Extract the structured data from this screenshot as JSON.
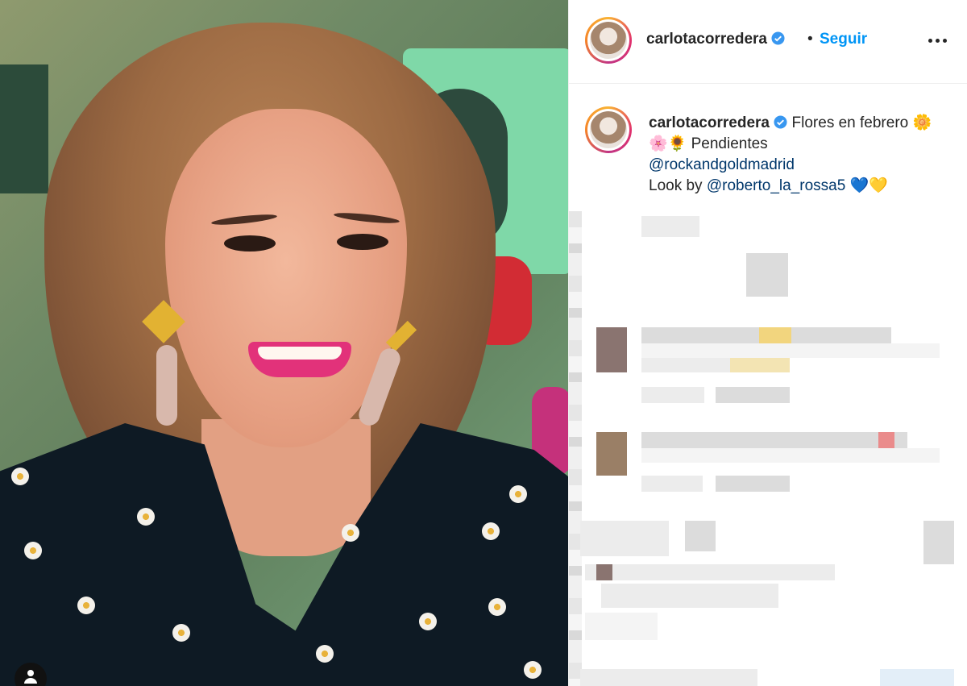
{
  "post": {
    "author": "carlotacorredera",
    "verified_icon": "verified-badge-icon",
    "separator": "•",
    "follow_label": "Seguir",
    "more_icon": "more-options-icon"
  },
  "caption": {
    "author": "carlotacorredera",
    "line1_text": "Flores en febrero",
    "emojis_1": "🌼🌸🌻",
    "line1_tail": "Pendientes",
    "mention_1": "@rockandgoldmadrid",
    "line3_prefix": "Look by",
    "mention_2": "@roberto_la_rossa5",
    "emojis_2": "💙💛"
  },
  "colors": {
    "accent": "#0095f6",
    "verified": "#3897f0",
    "mention": "#00376b",
    "text": "#262626"
  }
}
